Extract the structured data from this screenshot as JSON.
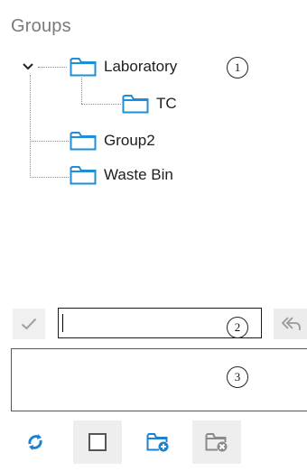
{
  "panel": {
    "title": "Groups"
  },
  "tree": {
    "root": {
      "label": "Laboratory",
      "expanded": true,
      "children": [
        {
          "label": "TC"
        }
      ]
    },
    "items": [
      {
        "label": "Group2"
      },
      {
        "label": "Waste Bin"
      }
    ]
  },
  "callouts": [
    "1",
    "2",
    "3"
  ],
  "editor": {
    "name_value": "",
    "description_value": ""
  },
  "toolbar": {
    "buttons": [
      {
        "icon": "refresh-icon"
      },
      {
        "icon": "checkbox-icon"
      },
      {
        "icon": "add-folder-icon"
      },
      {
        "icon": "delete-folder-icon"
      }
    ]
  },
  "colors": {
    "folder_stroke": "#1d8fd6",
    "accent_blue": "#1b82d2",
    "icon_gray": "#9a9a9a"
  }
}
